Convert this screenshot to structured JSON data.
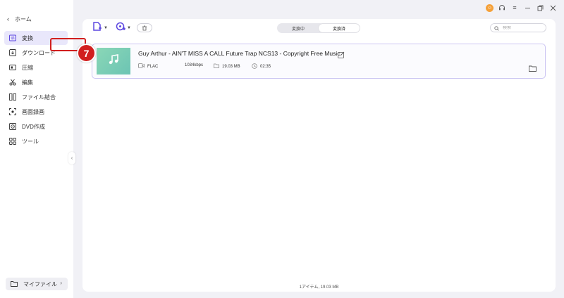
{
  "sidebar": {
    "home_label": "ホーム",
    "items": [
      {
        "label": "変換",
        "icon": "convert-icon",
        "active": true
      },
      {
        "label": "ダウンロード",
        "icon": "download-icon",
        "active": false
      },
      {
        "label": "圧縮",
        "icon": "compress-icon",
        "active": false
      },
      {
        "label": "編集",
        "icon": "scissors-icon",
        "active": false
      },
      {
        "label": "ファイル結合",
        "icon": "merge-icon",
        "active": false
      },
      {
        "label": "画面録画",
        "icon": "screen-record-icon",
        "active": false
      },
      {
        "label": "DVD作成",
        "icon": "dvd-icon",
        "active": false
      },
      {
        "label": "ツール",
        "icon": "tools-icon",
        "active": false
      }
    ],
    "my_files_label": "マイファイル"
  },
  "tabs": {
    "converting": "変換中",
    "converted": "変換済",
    "active": "converted"
  },
  "search": {
    "placeholder": "検索"
  },
  "file": {
    "title": "Guy Arthur - AIN'T MISS A CALL  Future Trap  NCS13 - Copyright Free Music",
    "format": "FLAC",
    "bitrate": "1034kbps",
    "size": "19.03 MB",
    "duration": "02:35"
  },
  "annotation": {
    "number": "7",
    "color": "#d11f1f"
  },
  "status_text": "1アイテム, 19.03 MB",
  "colors": {
    "accent": "#6a4ff5",
    "active_nav_bg": "#e9e7fb",
    "avatar": "#f5a13a"
  }
}
